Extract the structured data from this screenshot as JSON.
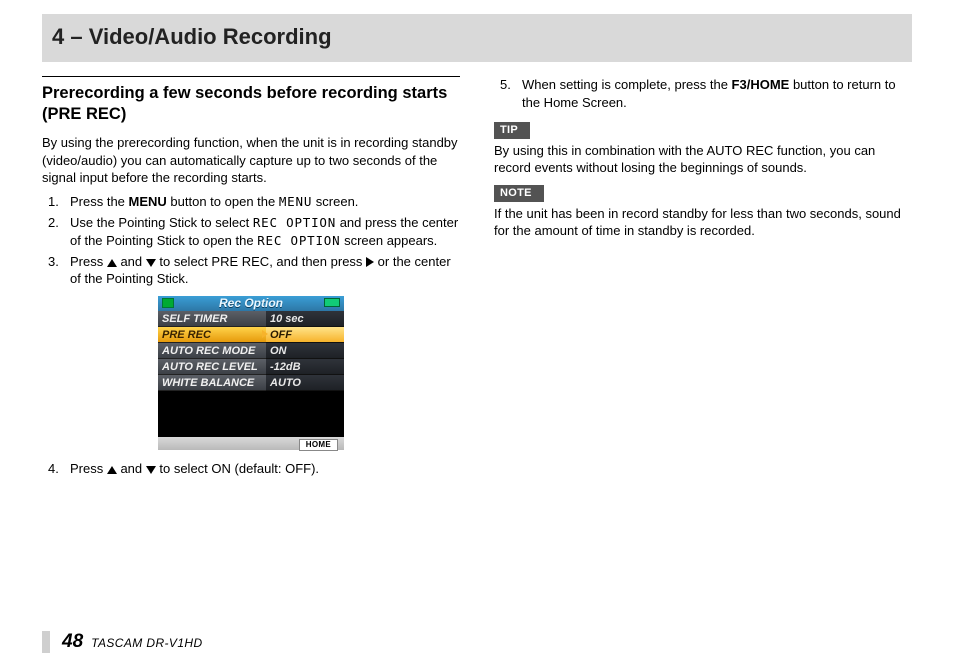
{
  "chapter_title": "4 – Video/Audio Recording",
  "section_title": "Prerecording a few seconds before recording starts (PRE REC)",
  "intro": "By using the prerecording function, when the unit is in recording standby (video/audio) you can automatically capture up to two seconds of the signal input before the recording starts.",
  "steps": {
    "s1a": "Press the ",
    "s1b": "MENU",
    "s1c": " button to open the ",
    "s1d": "MENU",
    "s1e": " screen.",
    "s2a": "Use the Pointing Stick to select ",
    "s2b": "REC OPTION",
    "s2c": " and press the center of the Pointing Stick to open the ",
    "s2d": "REC OPTION",
    "s2e": " screen appears.",
    "s3a": "Press ",
    "s3b": " and ",
    "s3c": " to select PRE REC, and then press ",
    "s3d": " or the center of the Pointing Stick.",
    "s4a": "Press ",
    "s4b": " and ",
    "s4c": " to select ON (default: OFF).",
    "s5a": "When setting is complete, press the ",
    "s5b": "F3/HOME",
    "s5c": " button to return to the Home Screen."
  },
  "device": {
    "title": "Rec Option",
    "home": "HOME",
    "rows": [
      {
        "label": "SELF TIMER",
        "value": "10 sec",
        "sel": false
      },
      {
        "label": "PRE REC",
        "value": "OFF",
        "sel": true
      },
      {
        "label": "AUTO REC MODE",
        "value": "ON",
        "sel": false
      },
      {
        "label": "AUTO REC LEVEL",
        "value": "-12dB",
        "sel": false
      },
      {
        "label": "WHITE BALANCE",
        "value": "AUTO",
        "sel": false
      }
    ]
  },
  "tip_label": "TIP",
  "tip_body": "By using this in combination with the AUTO REC function, you can record events without losing the beginnings of sounds.",
  "note_label": "NOTE",
  "note_body": "If the unit has been in record standby for less than two seconds, sound for the amount of time in standby is recorded.",
  "page_number": "48",
  "product": "TASCAM  DR-V1HD"
}
